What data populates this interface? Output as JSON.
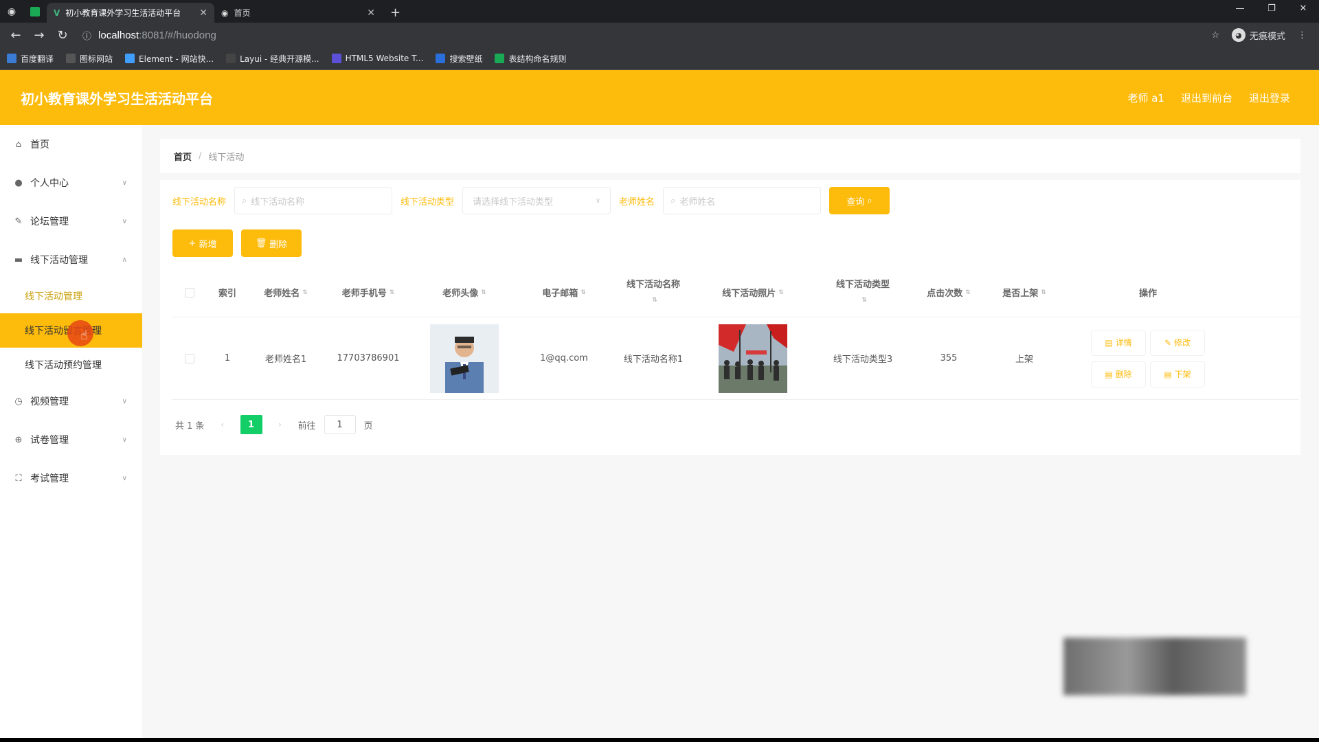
{
  "browser": {
    "tabs": [
      {
        "title": "初小教育课外学习生活活动平台",
        "active": true
      },
      {
        "title": "首页",
        "active": false
      }
    ],
    "url_host": "localhost",
    "url_path": ":8081/#/huodong",
    "incognito_label": "无痕模式",
    "bookmarks": [
      {
        "label": "百度翻译",
        "color": "#3a7bd5"
      },
      {
        "label": "图标网站",
        "color": "#555555"
      },
      {
        "label": "Element - 网站快...",
        "color": "#409eff"
      },
      {
        "label": "Layui - 经典开源模...",
        "color": "#444444"
      },
      {
        "label": "HTML5 Website T...",
        "color": "#5b50d6"
      },
      {
        "label": "搜索壁纸",
        "color": "#2a6edb"
      },
      {
        "label": "表结构命名规则",
        "color": "#1aaa55"
      }
    ]
  },
  "header": {
    "brand": "初小教育课外学习生活活动平台",
    "user": "老师 a1",
    "to_front": "退出到前台",
    "logout": "退出登录",
    "accent": "#fdbb0b"
  },
  "sidebar": {
    "items": [
      {
        "label": "首页",
        "icon": "home-icon"
      },
      {
        "label": "个人中心",
        "icon": "user-icon"
      },
      {
        "label": "论坛管理",
        "icon": "forum-icon"
      },
      {
        "label": "线下活动管理",
        "icon": "activity-icon"
      }
    ],
    "sub_items": [
      {
        "label": "线下活动管理"
      },
      {
        "label": "线下活动留言管理"
      },
      {
        "label": "线下活动预约管理"
      }
    ],
    "items_after": [
      {
        "label": "视频管理",
        "icon": "video-icon"
      },
      {
        "label": "试卷管理",
        "icon": "paper-icon"
      },
      {
        "label": "考试管理",
        "icon": "exam-icon"
      }
    ]
  },
  "breadcrumb": {
    "home": "首页",
    "current": "线下活动"
  },
  "search": {
    "name_label": "线下活动名称",
    "name_placeholder": "线下活动名称",
    "type_label": "线下活动类型",
    "type_placeholder": "请选择线下活动类型",
    "teacher_label": "老师姓名",
    "teacher_placeholder": "老师姓名",
    "query_btn": "查询"
  },
  "actions": {
    "add": "新增",
    "delete": "删除"
  },
  "table": {
    "headers": {
      "index": "索引",
      "teacher_name": "老师姓名",
      "teacher_phone": "老师手机号",
      "teacher_avatar": "老师头像",
      "email": "电子邮箱",
      "activity_name": "线下活动名称",
      "activity_photo": "线下活动照片",
      "activity_type": "线下活动类型",
      "clicks": "点击次数",
      "on_shelf": "是否上架",
      "ops": "操作"
    },
    "rows": [
      {
        "index": "1",
        "teacher_name": "老师姓名1",
        "teacher_phone": "17703786901",
        "email": "1@qq.com",
        "activity_name": "线下活动名称1",
        "activity_type": "线下活动类型3",
        "clicks": "355",
        "on_shelf": "上架"
      }
    ],
    "ops": {
      "detail": "详情",
      "edit": "修改",
      "delete": "删除",
      "off_shelf": "下架"
    }
  },
  "pager": {
    "total": "共 1 条",
    "page": "1",
    "goto": "前往",
    "goto_value": "1",
    "page_unit": "页"
  }
}
